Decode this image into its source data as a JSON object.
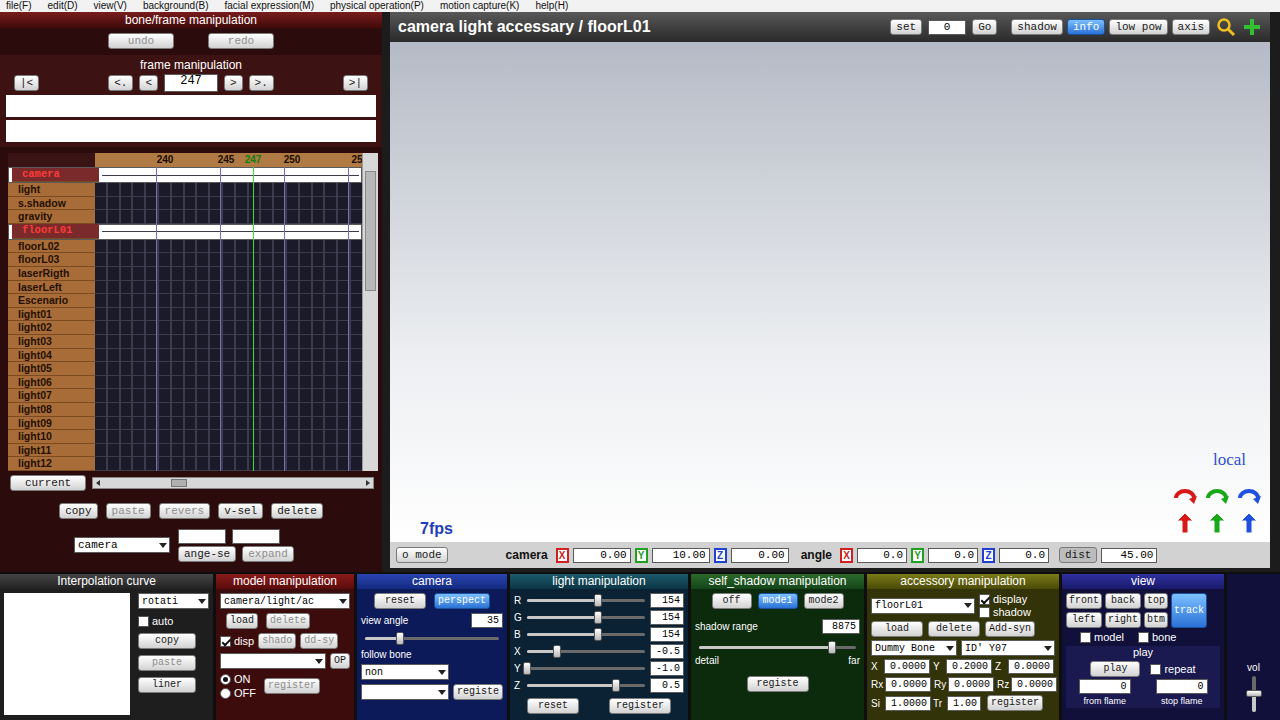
{
  "menu": [
    "file(F)",
    "edit(D)",
    "view(V)",
    "background(B)",
    "facial expression(M)",
    "physical operation(P)",
    "motion capture(K)",
    "help(H)"
  ],
  "bone_frame": {
    "title": "bone/frame manipulation",
    "undo": {
      "label": "undo",
      "disabled": true
    },
    "redo": {
      "label": "redo",
      "disabled": true
    }
  },
  "frame": {
    "title": "frame manipulation",
    "nav_back": [
      "|<",
      "<.",
      "<"
    ],
    "value": "247",
    "nav_fwd": [
      ">",
      ">.",
      ">|"
    ]
  },
  "timeline": {
    "ruler": [
      {
        "label": "240",
        "current": false
      },
      {
        "label": "245",
        "current": false
      },
      {
        "label": "247",
        "current": true
      },
      {
        "label": "250",
        "current": false
      },
      {
        "label": "25",
        "current": false
      }
    ],
    "tracks": [
      {
        "name": "camera",
        "selected": true
      },
      {
        "name": "light",
        "selected": false
      },
      {
        "name": "s.shadow",
        "selected": false
      },
      {
        "name": "gravity",
        "selected": false
      },
      {
        "name": "floorL01",
        "selected": true
      },
      {
        "name": "floorL02",
        "selected": false
      },
      {
        "name": "floorL03",
        "selected": false
      },
      {
        "name": "laserRigth",
        "selected": false
      },
      {
        "name": "laserLeft",
        "selected": false
      },
      {
        "name": "Escenario",
        "selected": false
      },
      {
        "name": "light01",
        "selected": false
      },
      {
        "name": "light02",
        "selected": false
      },
      {
        "name": "light03",
        "selected": false
      },
      {
        "name": "light04",
        "selected": false
      },
      {
        "name": "light05",
        "selected": false
      },
      {
        "name": "light06",
        "selected": false
      },
      {
        "name": "light07",
        "selected": false
      },
      {
        "name": "light08",
        "selected": false
      },
      {
        "name": "light09",
        "selected": false
      },
      {
        "name": "light10",
        "selected": false
      },
      {
        "name": "light11",
        "selected": false
      },
      {
        "name": "light12",
        "selected": false
      }
    ],
    "current": "current"
  },
  "edit": {
    "buttons": [
      {
        "label": "copy",
        "disabled": false
      },
      {
        "label": "paste",
        "disabled": true
      },
      {
        "label": "revers",
        "disabled": true
      },
      {
        "label": "v-sel",
        "disabled": false
      },
      {
        "label": "delete",
        "disabled": false
      }
    ],
    "target": "camera",
    "range": {
      "label": "ange-se",
      "disabled": false
    },
    "expand": {
      "label": "expand",
      "disabled": true
    }
  },
  "viewport": {
    "title": "camera light accessary / floorL01",
    "set": "set",
    "frame": "0",
    "go": "Go",
    "toggles": [
      {
        "label": "shadow",
        "on": false
      },
      {
        "label": "info",
        "on": true
      },
      {
        "label": "low pow",
        "on": false
      },
      {
        "label": "axis",
        "on": false
      }
    ],
    "fps": "7fps",
    "space": "local"
  },
  "status": {
    "mode": "o mode",
    "camera_label": "camera",
    "camera": [
      {
        "axis": "X",
        "value": "0.00",
        "color": "#d02020"
      },
      {
        "axis": "Y",
        "value": "10.00",
        "color": "#20a020"
      },
      {
        "axis": "Z",
        "value": "0.00",
        "color": "#2040d0"
      }
    ],
    "angle_label": "angle",
    "angle": [
      {
        "axis": "X",
        "value": "0.0",
        "color": "#d02020"
      },
      {
        "axis": "Y",
        "value": "0.0",
        "color": "#20a020"
      },
      {
        "axis": "Z",
        "value": "0.0",
        "color": "#2040d0"
      }
    ],
    "dist_label": "dist",
    "dist": "45.00"
  },
  "interp": {
    "title": "Interpolation curve",
    "type": "rotati",
    "auto": {
      "label": "auto",
      "checked": false
    },
    "copy": "copy",
    "paste": {
      "label": "paste",
      "disabled": true
    },
    "liner": "liner"
  },
  "model": {
    "title": "model manipulation",
    "select": "camera/light/ac",
    "load": "load",
    "delete": {
      "label": "delete",
      "disabled": true
    },
    "disp": {
      "label": "disp",
      "checked": true
    },
    "shadow": {
      "label": "shado",
      "disabled": true
    },
    "sync": {
      "label": "dd-sy",
      "disabled": true
    },
    "op": "OP",
    "power": [
      {
        "label": "ON",
        "selected": true
      },
      {
        "label": "OFF",
        "selected": false
      }
    ],
    "register": {
      "label": "register",
      "disabled": true
    }
  },
  "camera": {
    "title": "camera",
    "reset": "reset",
    "perspective": {
      "label": "perspect",
      "on": true
    },
    "view_angle_label": "view angle",
    "view_angle": "35",
    "view_angle_level": 0.26,
    "follow_label": "follow bone",
    "follow": "non",
    "register": "registe"
  },
  "light": {
    "title": "light manipulation",
    "sliders": [
      {
        "label": "R",
        "value": "154",
        "level": 0.6
      },
      {
        "label": "G",
        "value": "154",
        "level": 0.6
      },
      {
        "label": "B",
        "value": "154",
        "level": 0.6
      },
      {
        "label": "X",
        "value": "-0.5",
        "level": 0.25
      },
      {
        "label": "Y",
        "value": "-1.0",
        "level": 0.0
      },
      {
        "label": "Z",
        "value": "0.5",
        "level": 0.75
      }
    ],
    "reset": "reset",
    "register": "register"
  },
  "shadow": {
    "title": "self_shadow manipulation",
    "modes": [
      {
        "label": "off",
        "selected": false
      },
      {
        "label": "mode1",
        "selected": true
      },
      {
        "label": "mode2",
        "selected": false
      }
    ],
    "range_label": "shadow range",
    "range": "8875",
    "range_level": 0.85,
    "detail": "detail",
    "far": "far",
    "register": "registe"
  },
  "accessory": {
    "title": "accessory manipulation",
    "select": "floorL01",
    "display": {
      "label": "display",
      "checked": true
    },
    "shadow": {
      "label": "shadow",
      "checked": false
    },
    "load": "load",
    "delete": "delete",
    "sync": "Add-syn",
    "bone_model": "Dummy Bone",
    "bone": "ID' Y07",
    "position": [
      {
        "label": "X",
        "value": "0.0000"
      },
      {
        "label": "Y",
        "value": "0.2000"
      },
      {
        "label": "Z",
        "value": "0.0000"
      }
    ],
    "rotation": [
      {
        "label": "Rx",
        "value": "0.0000"
      },
      {
        "label": "Ry",
        "value": "0.0000"
      },
      {
        "label": "Rz",
        "value": "0.0000"
      }
    ],
    "scale": {
      "label": "Si",
      "value": "1.0000"
    },
    "transparency": {
      "label": "Tr",
      "value": "1.00"
    },
    "register": "register"
  },
  "view": {
    "title": "view",
    "buttons": [
      "front",
      "back",
      "top",
      "left",
      "right",
      "btm"
    ],
    "track": {
      "label": "track",
      "on": true
    },
    "model": {
      "label": "model",
      "checked": false
    },
    "bone": {
      "label": "bone",
      "checked": false
    }
  },
  "play": {
    "title": "play",
    "play": "play",
    "repeat": {
      "label": "repeat",
      "checked": false
    },
    "from": "0",
    "to": "0",
    "from_label": "from flame",
    "to_label": "stop flame"
  },
  "volume": {
    "label": "vol",
    "level": 0.5
  }
}
